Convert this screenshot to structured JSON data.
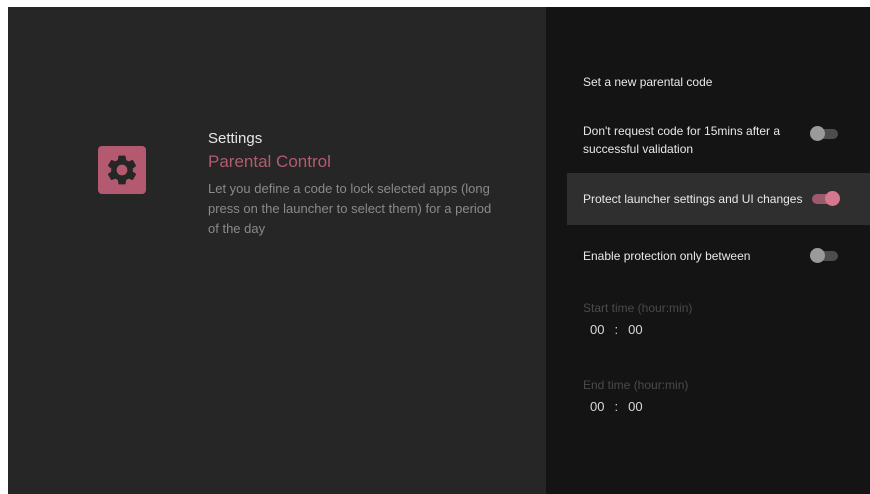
{
  "app": {
    "icon": "gear-icon",
    "accent_color": "#b45a70"
  },
  "info": {
    "settings_label": "Settings",
    "section_title": "Parental Control",
    "description": "Let you define a code to lock selected apps (long press on the launcher to select them) for a period of the day"
  },
  "options": {
    "new_code": {
      "label": "Set a new parental code"
    },
    "dont_request": {
      "label": "Don't request code for 15mins after a successful validation",
      "enabled": false
    },
    "protect_launcher": {
      "label": "Protect launcher settings and UI changes",
      "enabled": true
    },
    "enable_between": {
      "label": "Enable protection only between",
      "enabled": false
    }
  },
  "start_time": {
    "label": "Start time (hour:min)",
    "hour": "00",
    "separator": ":",
    "minute": "00"
  },
  "end_time": {
    "label": "End time (hour:min)",
    "hour": "00",
    "separator": ":",
    "minute": "00"
  }
}
